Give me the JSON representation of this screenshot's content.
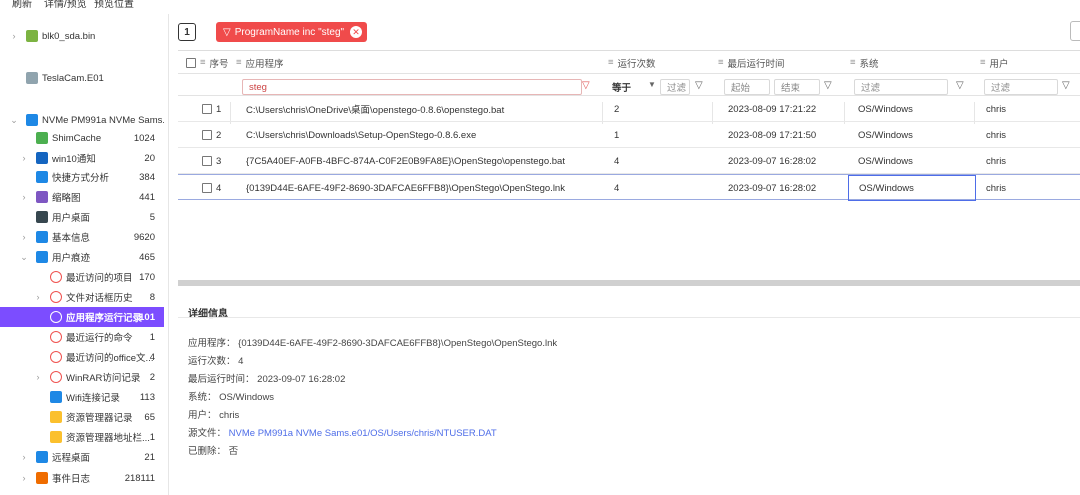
{
  "menu": {
    "items": [
      "刷新",
      "详情/预览",
      "预览位置"
    ]
  },
  "sidebar": {
    "items": [
      {
        "label": "blk0_sda.bin",
        "count": "",
        "level": 0,
        "chev": "›",
        "icon": "android-icon",
        "color": "#7cb342"
      },
      {
        "label": "TeslaCam.E01",
        "count": "",
        "level": 0,
        "chev": "",
        "icon": "disk-icon",
        "color": "#90a4ae"
      },
      {
        "label": "NVMe PM991a NVMe Sams...",
        "count": "",
        "level": 0,
        "chev": "⌄",
        "icon": "windows-icon",
        "color": "#1e88e5"
      },
      {
        "label": "ShimCache",
        "count": "1024",
        "level": 1,
        "chev": "",
        "icon": "shim-icon",
        "color": "#4caf50"
      },
      {
        "label": "win10通知",
        "count": "20",
        "level": 1,
        "chev": "›",
        "icon": "bell-icon",
        "color": "#1565c0"
      },
      {
        "label": "快捷方式分析",
        "count": "384",
        "level": 1,
        "chev": "",
        "icon": "shortcut-icon",
        "color": "#1e88e5"
      },
      {
        "label": "缩略图",
        "count": "441",
        "level": 1,
        "chev": "›",
        "icon": "thumbnail-icon",
        "color": "#7e57c2"
      },
      {
        "label": "用户桌面",
        "count": "5",
        "level": 1,
        "chev": "",
        "icon": "desktop-icon",
        "color": "#37474f"
      },
      {
        "label": "基本信息",
        "count": "9620",
        "level": 1,
        "chev": "›",
        "icon": "info-icon",
        "color": "#1e88e5"
      },
      {
        "label": "用户痕迹",
        "count": "465",
        "level": 1,
        "chev": "⌄",
        "icon": "footprint-icon",
        "color": "#1e88e5"
      },
      {
        "label": "最近访问的项目",
        "count": "170",
        "level": 2,
        "chev": "",
        "icon": "clock-icon",
        "color": "#ef5350"
      },
      {
        "label": "文件对话框历史",
        "count": "8",
        "level": 2,
        "chev": "›",
        "icon": "clock-icon",
        "color": "#ef5350"
      },
      {
        "label": "应用程序运行记录",
        "count": "101",
        "level": 2,
        "chev": "",
        "icon": "clock-icon",
        "color": "#ef5350",
        "active": true
      },
      {
        "label": "最近运行的命令",
        "count": "1",
        "level": 2,
        "chev": "",
        "icon": "clock-icon",
        "color": "#ef5350"
      },
      {
        "label": "最近访问的office文...",
        "count": "4",
        "level": 2,
        "chev": "",
        "icon": "clock-icon",
        "color": "#ef5350"
      },
      {
        "label": "WinRAR访问记录",
        "count": "2",
        "level": 2,
        "chev": "›",
        "icon": "clock-icon",
        "color": "#ef5350"
      },
      {
        "label": "Wifi连接记录",
        "count": "113",
        "level": 2,
        "chev": "",
        "icon": "wifi-icon",
        "color": "#1e88e5"
      },
      {
        "label": "资源管理器记录",
        "count": "65",
        "level": 2,
        "chev": "",
        "icon": "folder-icon",
        "color": "#fbc02d"
      },
      {
        "label": "资源管理器地址栏...",
        "count": "1",
        "level": 2,
        "chev": "",
        "icon": "folder-icon",
        "color": "#fbc02d"
      },
      {
        "label": "远程桌面",
        "count": "21",
        "level": 1,
        "chev": "›",
        "icon": "remote-desktop-icon",
        "color": "#1e88e5"
      },
      {
        "label": "事件日志",
        "count": "218111",
        "level": 1,
        "chev": "›",
        "icon": "event-log-icon",
        "color": "#ef6c00"
      }
    ]
  },
  "filter": {
    "page_indicator": "1",
    "chip_label": "ProgramName inc \"steg\""
  },
  "grid": {
    "headers": {
      "index": "序号",
      "program": "应用程序",
      "runs": "运行次数",
      "last_run": "最后运行时间",
      "system": "系统",
      "user": "用户"
    },
    "filters": {
      "program_value": "steg",
      "runs_op": "等于",
      "runs_filter": "过滤",
      "start": "起始",
      "end": "结束",
      "system_filter": "过滤",
      "user_filter": "过滤"
    },
    "rows": [
      {
        "index": "1",
        "program": "C:\\Users\\chris\\OneDrive\\桌面\\openstego-0.8.6\\openstego.bat",
        "runs": "2",
        "last_run": "2023-08-09 17:21:22",
        "system": "OS/Windows",
        "user": "chris"
      },
      {
        "index": "2",
        "program": "C:\\Users\\chris\\Downloads\\Setup-OpenStego-0.8.6.exe",
        "runs": "1",
        "last_run": "2023-08-09 17:21:50",
        "system": "OS/Windows",
        "user": "chris"
      },
      {
        "index": "3",
        "program": "{7C5A40EF-A0FB-4BFC-874A-C0F2E0B9FA8E}\\OpenStego\\openstego.bat",
        "runs": "4",
        "last_run": "2023-09-07 16:28:02",
        "system": "OS/Windows",
        "user": "chris"
      },
      {
        "index": "4",
        "program": "{0139D44E-6AFE-49F2-8690-3DAFCAE6FFB8}\\OpenStego\\OpenStego.lnk",
        "runs": "4",
        "last_run": "2023-09-07 16:28:02",
        "system": "OS/Windows",
        "user": "chris",
        "selected": true
      }
    ]
  },
  "detail": {
    "title": "详细信息",
    "lines": [
      {
        "key": "应用程序：",
        "value": "{0139D44E-6AFE-49F2-8690-3DAFCAE6FFB8}\\OpenStego\\OpenStego.lnk"
      },
      {
        "key": "运行次数：",
        "value": "4"
      },
      {
        "key": "最后运行时间：",
        "value": "2023-09-07 16:28:02"
      },
      {
        "key": "系统：",
        "value": "OS/Windows"
      },
      {
        "key": "用户：",
        "value": "chris"
      },
      {
        "key": "源文件：",
        "value": "NVMe PM991a NVMe Sams.e01/OS/Users/chris/NTUSER.DAT",
        "link": true
      },
      {
        "key": "已删除：",
        "value": "否"
      }
    ]
  },
  "colors": {
    "accent": "#7c4dff",
    "chip": "#f04b4b",
    "link": "#4e6de8"
  }
}
